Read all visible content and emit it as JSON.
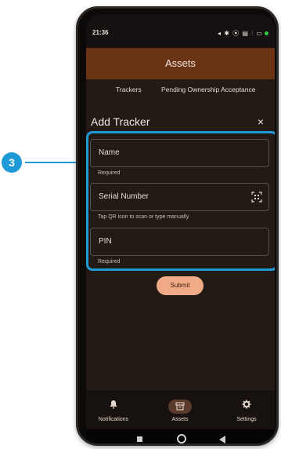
{
  "status": {
    "time": "21:36",
    "icons_text": "◂ ✱ ⦿ ▤ ⫶ ▭"
  },
  "app": {
    "title": "Assets"
  },
  "tabs": [
    {
      "label": "Trackers"
    },
    {
      "label": "Pending Ownership Acceptance"
    }
  ],
  "dialog": {
    "title": "Add Tracker",
    "close_icon": "×",
    "fields": [
      {
        "label": "Name",
        "helper": "Required"
      },
      {
        "label": "Serial Number",
        "helper": "Tap QR icon to scan or type manually"
      },
      {
        "label": "PIN",
        "helper": "Required"
      }
    ],
    "submit_label": "Submit"
  },
  "nav": [
    {
      "label": "Notifications",
      "icon": "bell-icon"
    },
    {
      "label": "Assets",
      "icon": "archive-icon"
    },
    {
      "label": "Settings",
      "icon": "gear-icon"
    }
  ],
  "callout": {
    "number": "3"
  },
  "colors": {
    "accent": "#1e9ad6",
    "appbar": "#6a3414",
    "submit": "#f2aa86"
  }
}
